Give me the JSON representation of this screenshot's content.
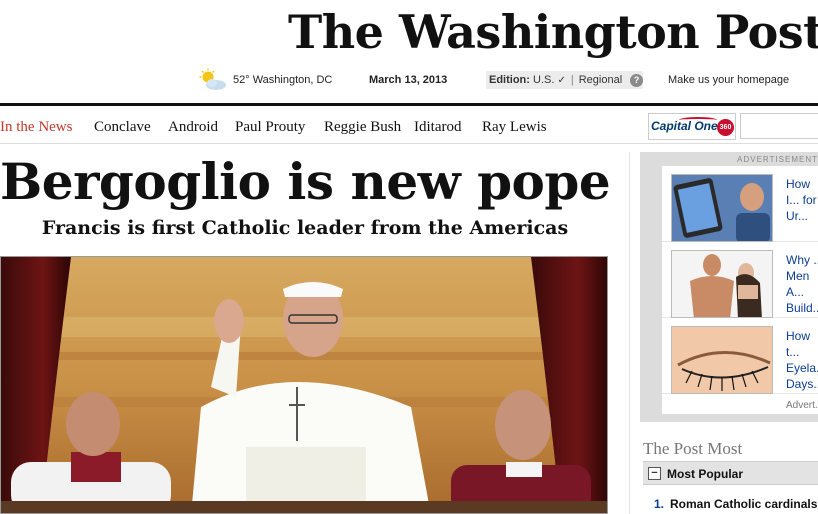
{
  "masthead": {
    "logo_text": "The Washington Post",
    "weather_icon": "sun-cloud-icon",
    "weather": "52° Washington, DC",
    "date": "March 13, 2013",
    "edition_label": "Edition:",
    "edition_value": "U.S.",
    "edition_alt": "Regional",
    "help_glyph": "?",
    "homepage_link": "Make us your homepage"
  },
  "nav": {
    "items": [
      {
        "label": "In the News"
      },
      {
        "label": "Conclave"
      },
      {
        "label": "Android"
      },
      {
        "label": "Paul Prouty"
      },
      {
        "label": "Reggie Bush"
      },
      {
        "label": "Iditarod"
      },
      {
        "label": "Ray Lewis"
      }
    ],
    "sponsor": "Capital One"
  },
  "lead_story": {
    "headline": "Bergoglio is new pope",
    "subhead": "Francis is first Catholic leader from the Americas"
  },
  "ads": {
    "label": "ADVERTISEMENT",
    "items": [
      {
        "text": "How I... for Ur..."
      },
      {
        "text": "Why ... Men A... Build..."
      },
      {
        "text": "How t... Eyela... Days..."
      }
    ],
    "footer": "Advert..."
  },
  "post_most": {
    "title": "The Post Most",
    "tab_label": "Most Popular",
    "stories": [
      {
        "num": "1.",
        "title": "Roman Catholic cardinals"
      }
    ]
  },
  "colors": {
    "accent_red": "#c0392b",
    "link_blue": "#0b3d91"
  }
}
